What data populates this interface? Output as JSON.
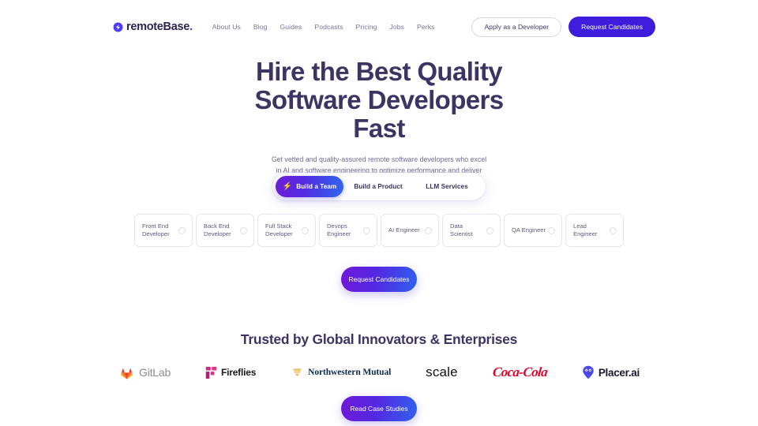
{
  "header": {
    "brand": {
      "name": "remoteBase",
      "dot": ".",
      "icon": "globe-icon"
    },
    "nav": [
      {
        "label": "About Us"
      },
      {
        "label": "Blog"
      },
      {
        "label": "Guides"
      },
      {
        "label": "Podcasts"
      },
      {
        "label": "Pricing"
      },
      {
        "label": "Jobs"
      },
      {
        "label": "Perks"
      }
    ],
    "apply_label": "Apply as a Developer",
    "request_label": "Request Candidates"
  },
  "hero": {
    "title": "Hire the Best Quality Software Developers Fast",
    "subtitle": "Get vetted and quality-assured remote software developers who excel in AI and software engineering to optimize performance and deliver innovative solutions."
  },
  "switcher": {
    "tabs": [
      {
        "label": "Build a Team",
        "icon": "lightning-bolt-icon",
        "active": true
      },
      {
        "label": "Build a Product",
        "active": false
      },
      {
        "label": "LLM Services",
        "active": false
      }
    ]
  },
  "roles": [
    {
      "label": "Front End Developer",
      "selected": false
    },
    {
      "label": "Back End Developer",
      "selected": false
    },
    {
      "label": "Full Stack Developer",
      "selected": false
    },
    {
      "label": "Devops Engineer",
      "selected": false
    },
    {
      "label": "AI Engineer",
      "selected": false
    },
    {
      "label": "Data Scientist",
      "selected": false
    },
    {
      "label": "QA Engineer",
      "selected": false
    },
    {
      "label": "Lead Engineer",
      "selected": false
    }
  ],
  "cta": {
    "request_candidates": "Request Candidates",
    "read_case_studies": "Read Case Studies"
  },
  "trusted": {
    "title": "Trusted by Global Innovators & Enterprises",
    "logos": [
      {
        "name": "GitLab",
        "icon": "gitlab-tanuki-icon"
      },
      {
        "name": "Fireflies",
        "icon": "fireflies-icon"
      },
      {
        "name": "Northwestern Mutual",
        "icon": "northwestern-mutual-crest-icon"
      },
      {
        "name": "scale",
        "icon": ""
      },
      {
        "name": "Coca-Cola",
        "icon": ""
      },
      {
        "name": "Placer.ai",
        "icon": "placer-pin-icon"
      }
    ]
  },
  "colors": {
    "brand_purple": "#4d3df7",
    "cta_solid": "#3d1ddb",
    "gradient_start": "#7118d8",
    "gradient_end": "#2f62ef",
    "heading": "#3a3563",
    "body_text": "#6f6b90"
  }
}
